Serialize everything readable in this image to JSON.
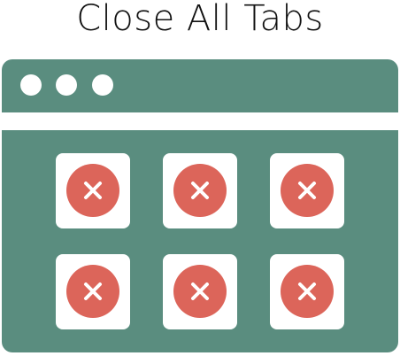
{
  "title": "Close All Tabs",
  "colors": {
    "window": "#5a8d7f",
    "close": "#dc655a"
  },
  "tabs": [
    {
      "icon": "close-icon"
    },
    {
      "icon": "close-icon"
    },
    {
      "icon": "close-icon"
    },
    {
      "icon": "close-icon"
    },
    {
      "icon": "close-icon"
    },
    {
      "icon": "close-icon"
    }
  ]
}
